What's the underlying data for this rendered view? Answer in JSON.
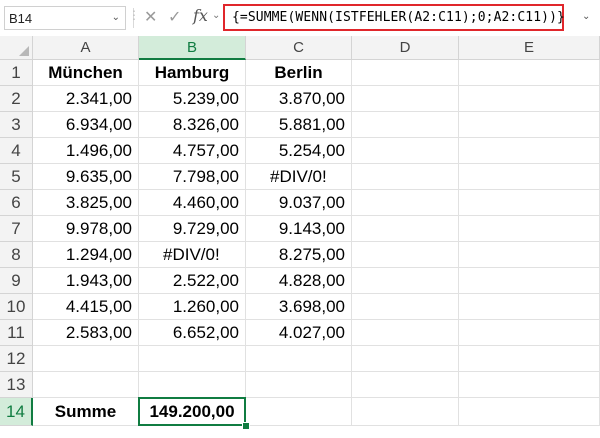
{
  "formula_bar": {
    "name_box": "B14",
    "formula": "{=SUMME(WENN(ISTFEHLER(A2:C11);0;A2:C11))}",
    "fx_label": "fx"
  },
  "columns": [
    "A",
    "B",
    "C",
    "D",
    "E"
  ],
  "selected_cell": "B14",
  "rows": [
    {
      "n": "1",
      "cells": [
        "München",
        "Hamburg",
        "Berlin",
        "",
        ""
      ]
    },
    {
      "n": "2",
      "cells": [
        "2.341,00",
        "5.239,00",
        "3.870,00",
        "",
        ""
      ]
    },
    {
      "n": "3",
      "cells": [
        "6.934,00",
        "8.326,00",
        "5.881,00",
        "",
        ""
      ]
    },
    {
      "n": "4",
      "cells": [
        "1.496,00",
        "4.757,00",
        "5.254,00",
        "",
        ""
      ]
    },
    {
      "n": "5",
      "cells": [
        "9.635,00",
        "7.798,00",
        "#DIV/0!",
        "",
        ""
      ]
    },
    {
      "n": "6",
      "cells": [
        "3.825,00",
        "4.460,00",
        "9.037,00",
        "",
        ""
      ]
    },
    {
      "n": "7",
      "cells": [
        "9.978,00",
        "9.729,00",
        "9.143,00",
        "",
        ""
      ]
    },
    {
      "n": "8",
      "cells": [
        "1.294,00",
        "#DIV/0!",
        "8.275,00",
        "",
        ""
      ]
    },
    {
      "n": "9",
      "cells": [
        "1.943,00",
        "2.522,00",
        "4.828,00",
        "",
        ""
      ]
    },
    {
      "n": "10",
      "cells": [
        "4.415,00",
        "1.260,00",
        "3.698,00",
        "",
        ""
      ]
    },
    {
      "n": "11",
      "cells": [
        "2.583,00",
        "6.652,00",
        "4.027,00",
        "",
        ""
      ]
    },
    {
      "n": "12",
      "cells": [
        "",
        "",
        "",
        "",
        ""
      ]
    },
    {
      "n": "13",
      "cells": [
        "",
        "",
        "",
        "",
        ""
      ]
    },
    {
      "n": "14",
      "cells": [
        "Summe",
        "149.200,00",
        "",
        "",
        ""
      ]
    }
  ],
  "icons": {
    "cancel": "close-icon",
    "confirm": "check-icon",
    "function": "fx-icon"
  }
}
